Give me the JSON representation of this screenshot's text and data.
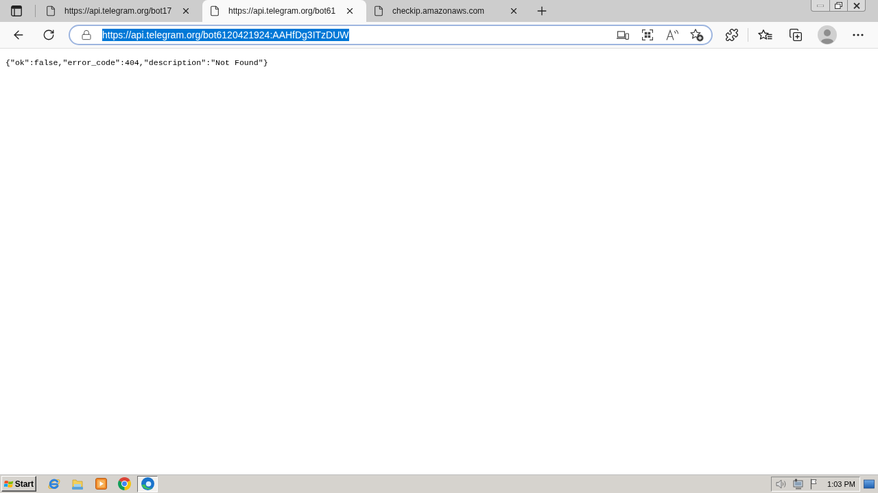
{
  "tabs": [
    {
      "title": "https://api.telegram.org/bot17",
      "selected": false
    },
    {
      "title": "https://api.telegram.org/bot61",
      "selected": true
    },
    {
      "title": "checkip.amazonaws.com",
      "selected": false
    }
  ],
  "address_bar": {
    "url": "https://api.telegram.org/bot6120421924:AAHfDg3ITzDUW",
    "url_selected": true
  },
  "page": {
    "body_text": "{\"ok\":false,\"error_code\":404,\"description\":\"Not Found\"}"
  },
  "taskbar": {
    "start_label": "Start",
    "apps": [
      {
        "kind": "ie",
        "selected": false
      },
      {
        "kind": "explorer",
        "selected": false
      },
      {
        "kind": "media",
        "selected": false
      },
      {
        "kind": "chrome",
        "selected": false
      },
      {
        "kind": "edge",
        "selected": true
      }
    ],
    "clock": "1:03 PM"
  }
}
